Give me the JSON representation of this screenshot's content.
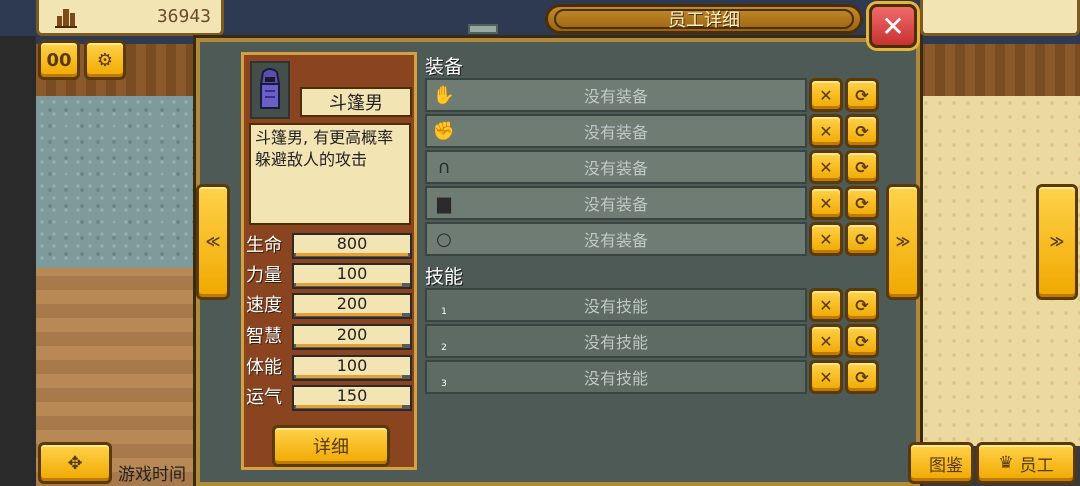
{
  "hud": {
    "money_icon": "building-icon",
    "money": "36943",
    "pause_label": "00",
    "speed_icon": "gears-icon",
    "game_time_label": "游戏时间",
    "illustration_label": "图鉴",
    "staff_label": "员工",
    "staff_icon": "crown-icon",
    "move_icon": "dpad-icon"
  },
  "dialog": {
    "title": "员工详细",
    "close_icon": "close-icon",
    "prev_icon": "double-chevron-left-icon",
    "next_icon": "double-chevron-right-icon"
  },
  "employee": {
    "name": "斗篷男",
    "description": "斗篷男, 有更高概率躲避敌人的攻击",
    "avatar_icon": "hooded-man-icon",
    "stats": [
      {
        "label": "生命",
        "value": "800",
        "fill": 1.0
      },
      {
        "label": "力量",
        "value": "100",
        "fill": 0.95
      },
      {
        "label": "速度",
        "value": "200",
        "fill": 0.95
      },
      {
        "label": "智慧",
        "value": "200",
        "fill": 0.95
      },
      {
        "label": "体能",
        "value": "100",
        "fill": 0.95
      },
      {
        "label": "运气",
        "value": "150",
        "fill": 0.95
      }
    ],
    "detail_label": "详细"
  },
  "equipment": {
    "heading": "装备",
    "slots": [
      {
        "icon": "glove-icon",
        "text": "没有装备"
      },
      {
        "icon": "gauntlet-icon",
        "text": "没有装备"
      },
      {
        "icon": "helmet-icon",
        "text": "没有装备"
      },
      {
        "icon": "armor-icon",
        "text": "没有装备"
      },
      {
        "icon": "ring-icon",
        "text": "没有装备"
      }
    ]
  },
  "skills": {
    "heading": "技能",
    "slots": [
      {
        "num": "1",
        "text": "没有技能"
      },
      {
        "num": "2",
        "text": "没有技能"
      },
      {
        "num": "3",
        "text": "没有技能"
      }
    ]
  },
  "slot_actions": {
    "remove_icon": "crossed-swords-icon",
    "swap_icon": "swap-icon"
  }
}
